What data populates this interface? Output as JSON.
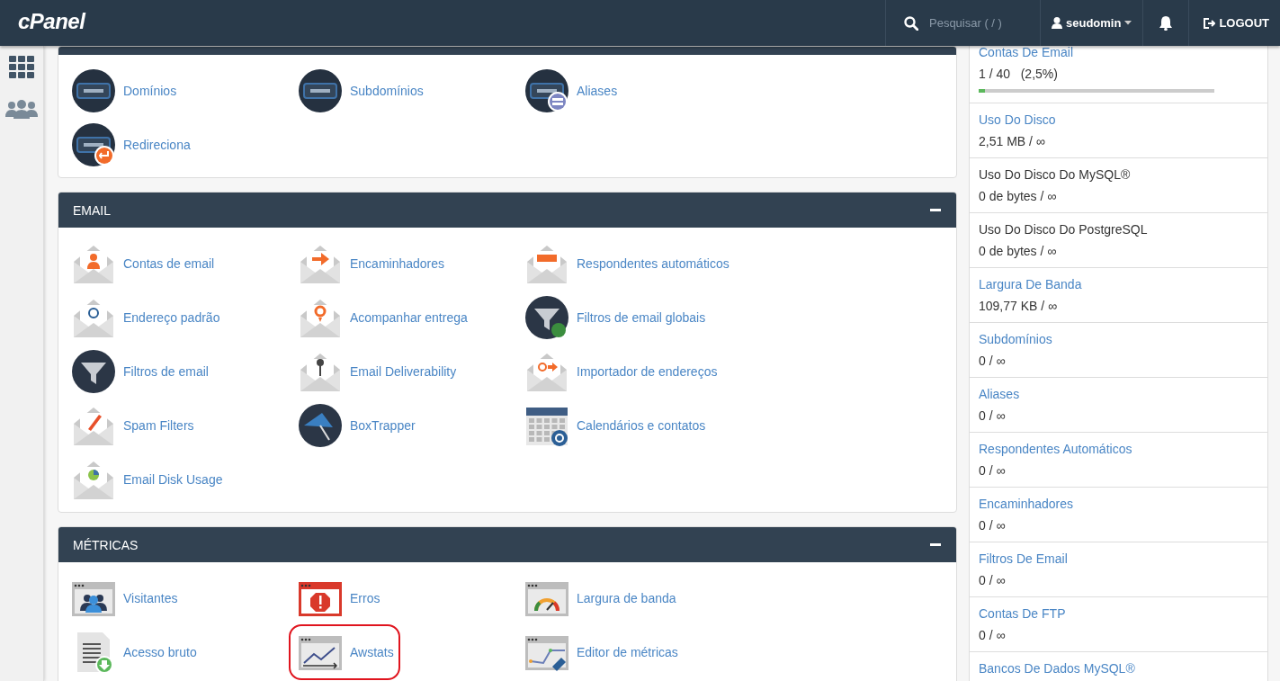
{
  "topbar": {
    "logo": "cPanel",
    "search": {
      "placeholder": "Pesquisar ( / )"
    },
    "user": "seudomin",
    "logout": "LOGOUT"
  },
  "panels": [
    {
      "items": [
        {
          "label": "Domínios",
          "highlighted": false
        },
        {
          "label": "Subdomínios",
          "highlighted": false
        },
        {
          "label": "Aliases",
          "highlighted": false
        },
        {
          "label": "Redireciona",
          "highlighted": false
        }
      ]
    },
    {
      "title": "EMAIL",
      "collapsed_icon": true,
      "items": [
        {
          "label": "Contas de email",
          "highlighted": false
        },
        {
          "label": "Encaminhadores",
          "highlighted": false
        },
        {
          "label": "Respondentes automáticos",
          "highlighted": false
        },
        {
          "label": "Endereço padrão",
          "highlighted": false
        },
        {
          "label": "Acompanhar entrega",
          "highlighted": false
        },
        {
          "label": "Filtros de email globais",
          "highlighted": false
        },
        {
          "label": "Filtros de email",
          "highlighted": false
        },
        {
          "label": "Email Deliverability",
          "highlighted": false
        },
        {
          "label": "Importador de endereços",
          "highlighted": false
        },
        {
          "label": "Spam Filters",
          "highlighted": false
        },
        {
          "label": "BoxTrapper",
          "highlighted": false
        },
        {
          "label": "Calendários e contatos",
          "highlighted": false
        },
        {
          "label": "Email Disk Usage",
          "highlighted": false
        }
      ]
    },
    {
      "title": "MÉTRICAS",
      "collapsed_icon": true,
      "items": [
        {
          "label": "Visitantes",
          "highlighted": false
        },
        {
          "label": "Erros",
          "highlighted": false
        },
        {
          "label": "Largura de banda",
          "highlighted": false
        },
        {
          "label": "Acesso bruto",
          "highlighted": false
        },
        {
          "label": "Awstats",
          "highlighted": true
        },
        {
          "label": "Editor de métricas",
          "highlighted": false
        }
      ]
    }
  ],
  "stats": [
    {
      "label": "Contas De Email",
      "link": true,
      "value": "1 / 40   (2,5%)",
      "level": 0.025
    },
    {
      "label": "Uso Do Disco",
      "link": true,
      "value": "2,51 MB / ∞"
    },
    {
      "label": "Uso Do Disco Do MySQL®",
      "link": false,
      "value": "0 de bytes / ∞"
    },
    {
      "label": "Uso Do Disco Do PostgreSQL",
      "link": false,
      "value": "0 de bytes / ∞"
    },
    {
      "label": "Largura De Banda",
      "link": true,
      "value": "109,77 KB / ∞"
    },
    {
      "label": "Subdomínios",
      "link": true,
      "value": "0 / ∞"
    },
    {
      "label": "Aliases",
      "link": true,
      "value": "0 / ∞"
    },
    {
      "label": "Respondentes Automáticos",
      "link": true,
      "value": "0 / ∞"
    },
    {
      "label": "Encaminhadores",
      "link": true,
      "value": "0 / ∞"
    },
    {
      "label": "Filtros De Email",
      "link": true,
      "value": "0 / ∞"
    },
    {
      "label": "Contas De FTP",
      "link": true,
      "value": "0 / ∞"
    },
    {
      "label": "Bancos De Dados MySQL®",
      "link": true
    }
  ]
}
